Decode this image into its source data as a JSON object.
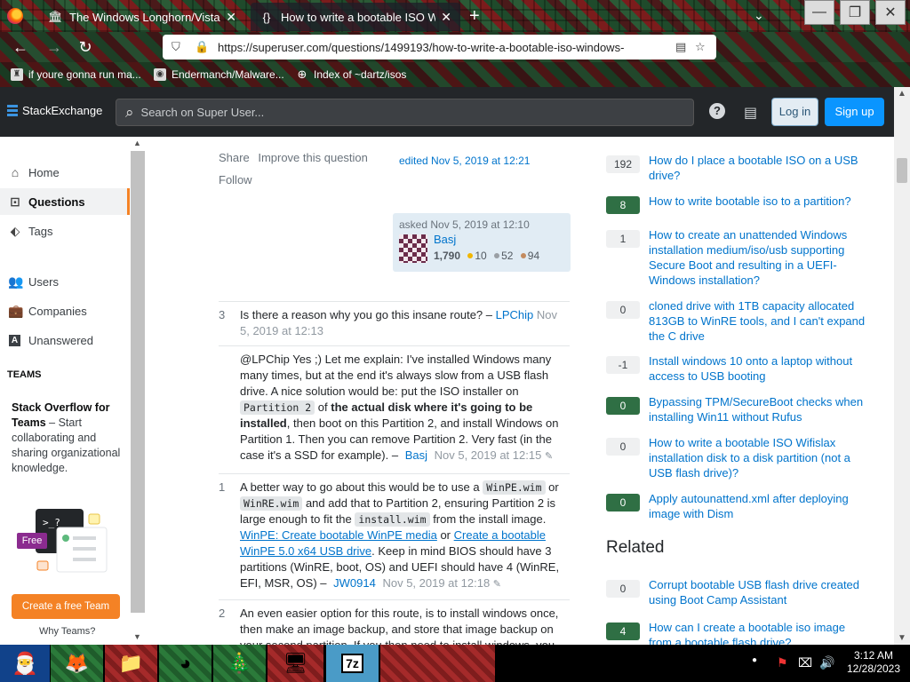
{
  "browser": {
    "tabs": [
      {
        "title": "The Windows Longhorn/Vista Arc",
        "icon": "columns-icon"
      },
      {
        "title": "How to write a bootable ISO Wind",
        "icon": "braces-icon"
      }
    ],
    "url": "https://superuser.com/questions/1499193/how-to-write-a-bootable-iso-windows-",
    "bookmarks": [
      {
        "label": "if youre gonna run ma..."
      },
      {
        "label": "Endermanch/Malware..."
      },
      {
        "label": "Index of ~dartz/isos"
      }
    ]
  },
  "header": {
    "logo_a": "Stack",
    "logo_b": "Exchange",
    "search_placeholder": "Search on Super User...",
    "login_label": "Log in",
    "signup_label": "Sign up"
  },
  "sidebar": {
    "items": [
      {
        "label": "Home",
        "icon": "home-icon"
      },
      {
        "label": "Questions",
        "icon": "globe-icon"
      },
      {
        "label": "Tags",
        "icon": "tag-icon"
      },
      {
        "label": "Users",
        "icon": "users-icon"
      },
      {
        "label": "Companies",
        "icon": "briefcase-icon"
      },
      {
        "label": "Unanswered",
        "icon": "letter-a-icon"
      }
    ],
    "teams_heading": "TEAMS",
    "teams_title": "Stack Overflow for Teams",
    "teams_text": "– Start collaborating and sharing organizational knowledge.",
    "free_badge": "Free",
    "teams_button": "Create a free Team",
    "why_teams": "Why Teams?"
  },
  "post": {
    "share": "Share",
    "improve": "Improve this question",
    "follow": "Follow",
    "edited": "edited Nov 5, 2019 at 12:21",
    "asked": "asked Nov 5, 2019 at 12:10",
    "user": "Basj",
    "rep": "1,790",
    "gold": "10",
    "silver": "52",
    "bronze": "94"
  },
  "comments": [
    {
      "score": "3",
      "text": "Is there a reason why you go this insane route? –",
      "user": "LPChip",
      "date": "Nov 5, 2019 at 12:13"
    },
    {
      "score": "",
      "p1": "@LPChip Yes ;) Let me explain: I've installed Windows many many times, but at the end it's always slow from a USB flash drive. A nice solution would be: put the ISO installer on",
      "code1": "Partition 2",
      "p2": "of",
      "bold": "the actual disk where it's going to be installed",
      "p3": ", then boot on this Partition 2, and install Windows on Partition 1. Then you can remove Partition 2. Very fast (in the case it's a SSD for example). –",
      "user": "Basj",
      "date": "Nov 5, 2019 at 12:15"
    },
    {
      "score": "1",
      "p1": "A better way to go about this would be to use a",
      "code1": "WinPE.wim",
      "p2": "or",
      "code2": "WinRE.wim",
      "p3": "and add that to Partition 2, ensuring Partition 2 is large enough to fit the",
      "code3": "install.wim",
      "p4": "from the install image.",
      "link1": "WinPE: Create bootable WinPE media",
      "p5": "or",
      "link2": "Create a bootable WinPE 5.0 x64 USB drive",
      "p6": ". Keep in mind BIOS should have 3 partitions (WinRE, boot, OS) and UEFI should have 4 (WinRE, EFI, MSR, OS) –",
      "user": "JW0914",
      "date": "Nov 5, 2019 at 12:18"
    },
    {
      "score": "2",
      "text": "An even easier option for this route, is to install windows once, then make an image backup, and store that image backup on your second partition. If you then need to install windows, you"
    }
  ],
  "linked": [
    {
      "count": "192",
      "accepted": false,
      "title": "How do I place a bootable ISO on a USB drive?"
    },
    {
      "count": "8",
      "accepted": true,
      "title": "How to write bootable iso to a partition?"
    },
    {
      "count": "1",
      "accepted": false,
      "title": "How to create an unattended Windows installation medium/iso/usb supporting Secure Boot and resulting in a UEFI-Windows installation?"
    },
    {
      "count": "0",
      "accepted": false,
      "title": "cloned drive with 1TB capacity allocated 813GB to WinRE tools, and I can't expand the C drive"
    },
    {
      "count": "-1",
      "accepted": false,
      "title": "Install windows 10 onto a laptop without access to USB booting"
    },
    {
      "count": "0",
      "accepted": true,
      "title": "Bypassing TPM/SecureBoot checks when installing Win11 without Rufus"
    },
    {
      "count": "0",
      "accepted": false,
      "title": "How to write a bootable ISO Wifislax installation disk to a disk partition (not a USB flash drive)?"
    },
    {
      "count": "0",
      "accepted": true,
      "title": "Apply autounattend.xml after deploying image with Dism"
    }
  ],
  "related_heading": "Related",
  "related": [
    {
      "count": "0",
      "accepted": false,
      "title": "Corrupt bootable USB flash drive created using Boot Camp Assistant"
    },
    {
      "count": "4",
      "accepted": true,
      "title": "How can I create a bootable iso image from a bootable flash drive?"
    }
  ],
  "taskbar": {
    "time": "3:12 AM",
    "date": "12/28/2023"
  }
}
